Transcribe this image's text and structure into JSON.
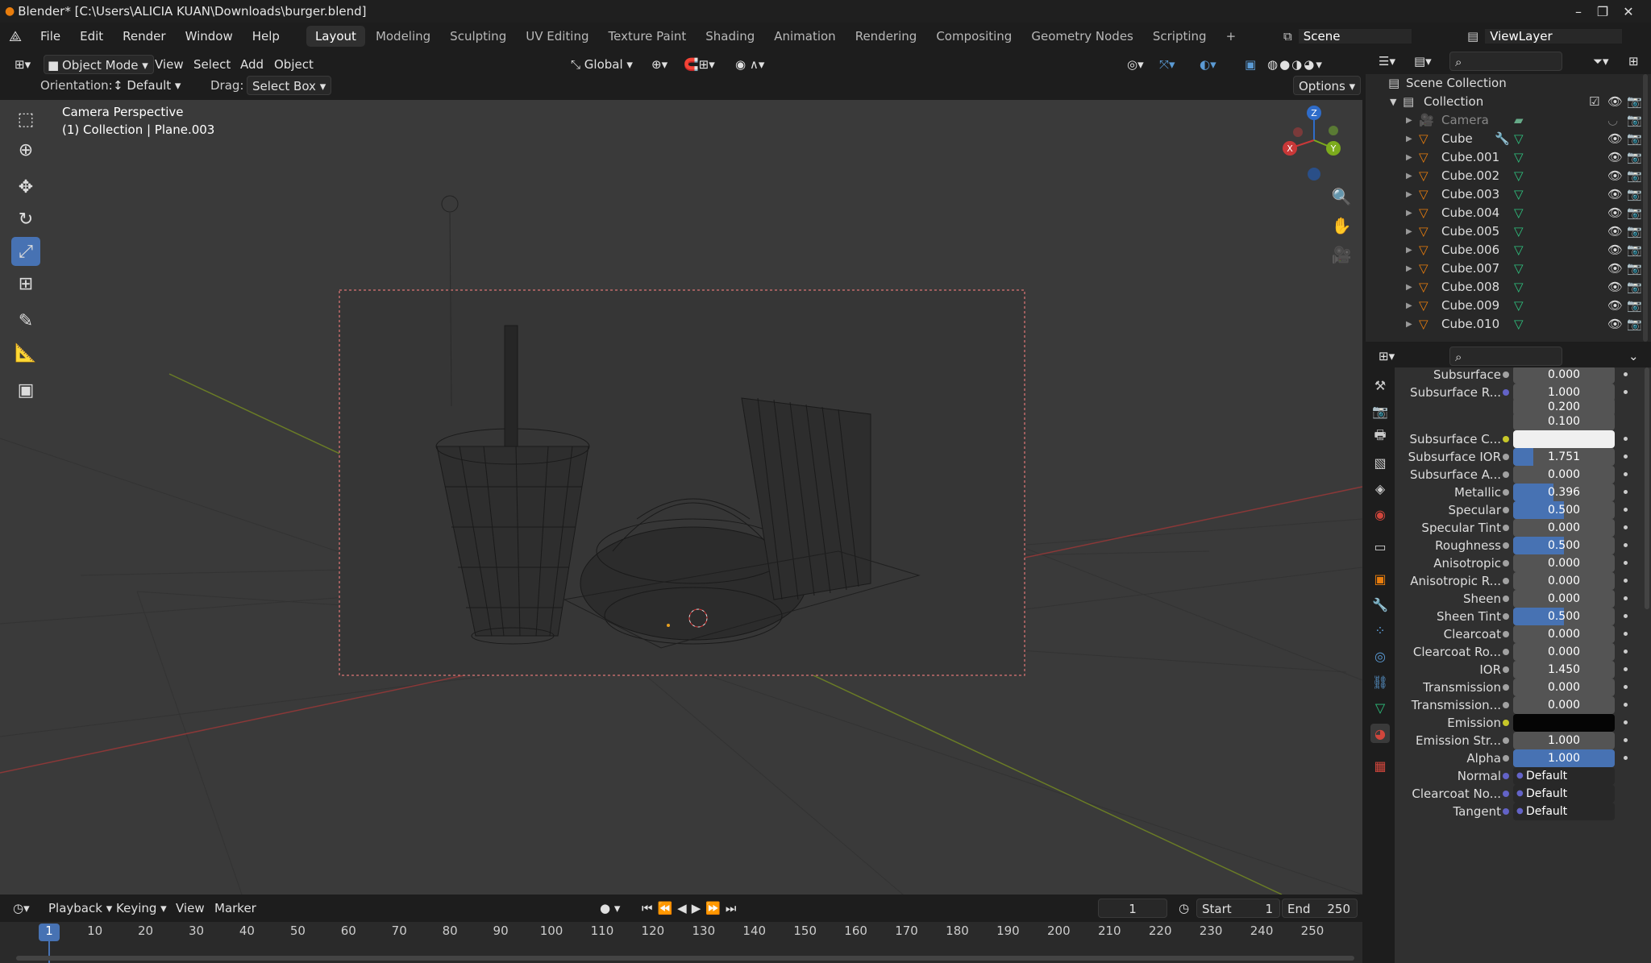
{
  "window": {
    "title": "Blender* [C:\\Users\\ALICIA KUAN\\Downloads\\burger.blend]",
    "controls": [
      "–",
      "❐",
      "✕"
    ]
  },
  "menubar": {
    "menus": [
      "File",
      "Edit",
      "Render",
      "Window",
      "Help"
    ],
    "workspaces": [
      "Layout",
      "Modeling",
      "Sculpting",
      "UV Editing",
      "Texture Paint",
      "Shading",
      "Animation",
      "Rendering",
      "Compositing",
      "Geometry Nodes",
      "Scripting"
    ],
    "active_workspace": "Layout",
    "add_tab": "+",
    "scene": "Scene",
    "view_layer": "ViewLayer"
  },
  "viewport_header": {
    "mode": "Object Mode",
    "menus": [
      "View",
      "Select",
      "Add",
      "Object"
    ],
    "transform_orientation": "Global",
    "orientation_label": "Orientation:",
    "orientation_value": "Default",
    "drag_label": "Drag:",
    "drag_value": "Select Box",
    "options": "Options"
  },
  "viewport": {
    "info_line1": "Camera Perspective",
    "info_line2": "(1) Collection | Plane.003",
    "gizmo_x": "X",
    "gizmo_y": "Y",
    "gizmo_z": "Z"
  },
  "outliner": {
    "root": "Scene Collection",
    "collection": "Collection",
    "items": [
      "Camera",
      "Cube",
      "Cube.001",
      "Cube.002",
      "Cube.003",
      "Cube.004",
      "Cube.005",
      "Cube.006",
      "Cube.007",
      "Cube.008",
      "Cube.009",
      "Cube.010"
    ]
  },
  "properties": {
    "rows": [
      {
        "label": "Subsurface",
        "value": "0.000",
        "fill": 0
      },
      {
        "label": "Subsurface R...",
        "value": "1.000",
        "fill": 0
      },
      {
        "label": "",
        "value": "0.200",
        "fill": 0
      },
      {
        "label": "",
        "value": "0.100",
        "fill": 0
      },
      {
        "label": "Subsurface C...",
        "value": "",
        "fill": 0
      },
      {
        "label": "Subsurface IOR",
        "value": "1.751",
        "fill": 0.2
      },
      {
        "label": "Subsurface A...",
        "value": "0.000",
        "fill": 0
      },
      {
        "label": "Metallic",
        "value": "0.396",
        "fill": 0.396
      },
      {
        "label": "Specular",
        "value": "0.500",
        "fill": 0.5
      },
      {
        "label": "Specular Tint",
        "value": "0.000",
        "fill": 0
      },
      {
        "label": "Roughness",
        "value": "0.500",
        "fill": 0.5
      },
      {
        "label": "Anisotropic",
        "value": "0.000",
        "fill": 0
      },
      {
        "label": "Anisotropic R...",
        "value": "0.000",
        "fill": 0
      },
      {
        "label": "Sheen",
        "value": "0.000",
        "fill": 0
      },
      {
        "label": "Sheen Tint",
        "value": "0.500",
        "fill": 0.5
      },
      {
        "label": "Clearcoat",
        "value": "0.000",
        "fill": 0
      },
      {
        "label": "Clearcoat Ro...",
        "value": "0.000",
        "fill": 0
      },
      {
        "label": "IOR",
        "value": "1.450",
        "fill": 0
      },
      {
        "label": "Transmission",
        "value": "0.000",
        "fill": 0
      },
      {
        "label": "Transmission...",
        "value": "0.000",
        "fill": 0
      },
      {
        "label": "Emission",
        "value": "",
        "fill": 0
      },
      {
        "label": "Emission Str...",
        "value": "1.000",
        "fill": 0
      },
      {
        "label": "Alpha",
        "value": "1.000",
        "fill": 1
      },
      {
        "label": "Normal",
        "value": "Default",
        "fill": 0
      },
      {
        "label": "Clearcoat No...",
        "value": "Default",
        "fill": 0
      },
      {
        "label": "Tangent",
        "value": "Default",
        "fill": 0
      }
    ]
  },
  "timeline": {
    "menus": [
      "Playback",
      "Keying",
      "View",
      "Marker"
    ],
    "current_frame": "1",
    "start_label": "Start",
    "start": "1",
    "end_label": "End",
    "end": "250",
    "ticks": [
      "1",
      "10",
      "20",
      "30",
      "40",
      "50",
      "60",
      "70",
      "80",
      "90",
      "100",
      "110",
      "120",
      "130",
      "140",
      "150",
      "160",
      "170",
      "180",
      "190",
      "200",
      "210",
      "220",
      "230",
      "240",
      "250"
    ]
  }
}
